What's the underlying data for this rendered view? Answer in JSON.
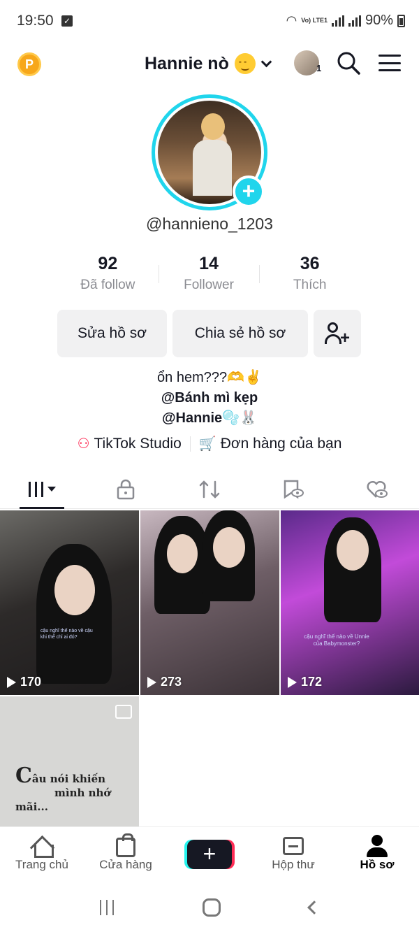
{
  "status_bar": {
    "time": "19:50",
    "network": "Vo) LTE1",
    "battery": "90%"
  },
  "header": {
    "username": "Hannie nò",
    "account_switch_count": "1"
  },
  "profile": {
    "handle": "@hannieno_1203",
    "stats": [
      {
        "value": "92",
        "label": "Đã follow"
      },
      {
        "value": "14",
        "label": "Follower"
      },
      {
        "value": "36",
        "label": "Thích"
      }
    ],
    "buttons": {
      "edit": "Sửa hồ sơ",
      "share": "Chia sẻ hồ sơ"
    },
    "bio": {
      "line1": "ổn hem???🫶✌️",
      "line2": "@Bánh mì kẹp",
      "line3": "@Hannie🫧🐰"
    },
    "links": {
      "studio": "TikTok Studio",
      "orders": "Đơn hàng của bạn"
    }
  },
  "videos": [
    {
      "views": "170",
      "caption": "cậu nghĩ thế nào về cậu khi thể chỉ ai đó?"
    },
    {
      "views": "273"
    },
    {
      "views": "172",
      "caption": "cậu nghĩ thế nào về Unnie của Babymonster?"
    }
  ],
  "photo_post": {
    "text_first_letter": "C",
    "text_rest": "âu nói khiến",
    "text_line2": "mình nhớ mãi..."
  },
  "bottom_nav": [
    {
      "label": "Trang chủ"
    },
    {
      "label": "Cửa hàng"
    },
    {
      "label": ""
    },
    {
      "label": "Hộp thư"
    },
    {
      "label": "Hồ sơ"
    }
  ],
  "colors": {
    "accent_cyan": "#20d5ec",
    "accent_pink": "#fe2c55",
    "coin": "#f7a71a"
  }
}
